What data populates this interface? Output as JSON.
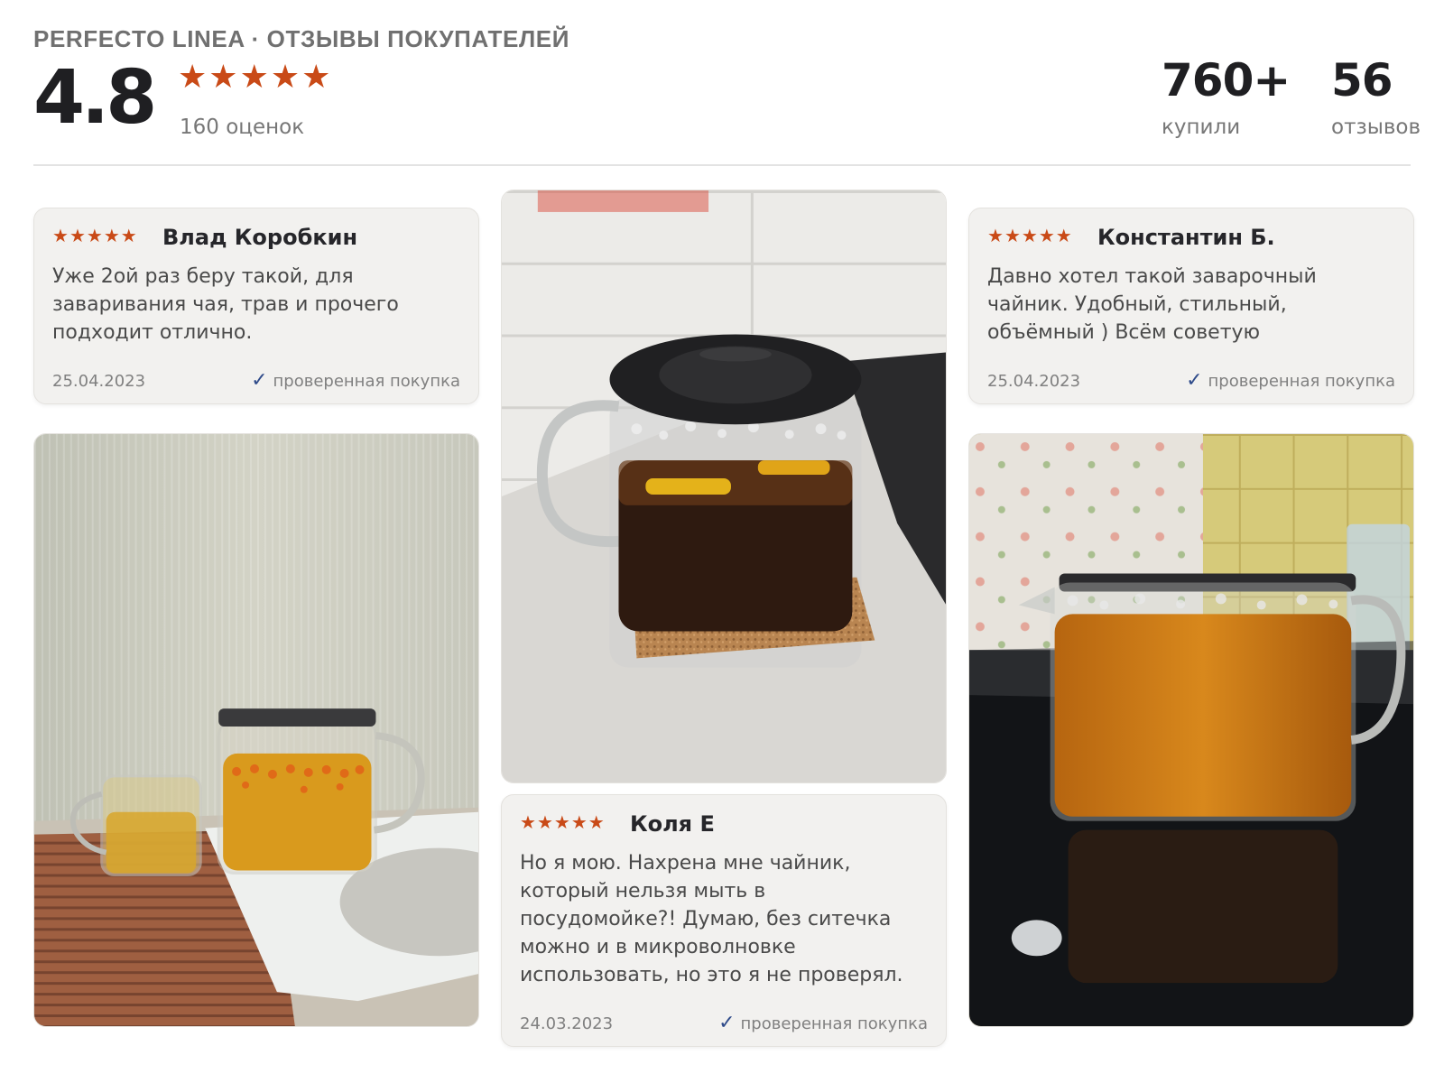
{
  "header": {
    "brand": "PERFECTO LINEA · ОТЗЫВЫ ПОКУПАТЕЛЕЙ",
    "rating": "4.8",
    "stars": 5,
    "ratings_count": "160 оценок",
    "bought": {
      "value": "760+",
      "label": "купили"
    },
    "reviews": {
      "value": "56",
      "label": "отзывов"
    }
  },
  "colors": {
    "star": "#c94a17",
    "check": "#2f4b8a",
    "card_bg": "#f2f1ef"
  },
  "reviews": [
    {
      "author": "Влад Коробкин",
      "stars": 5,
      "text": "Уже 2ой раз беру такой, для заваривания чая, трав и прочего подходит отлично.",
      "date": "25.04.2023",
      "verified": "проверенная покупка"
    },
    {
      "author": "Константин Б.",
      "stars": 5,
      "text": "Давно хотел такой заварочный чайник. Удобный, стильный, объёмный ) Всём советую",
      "date": "25.04.2023",
      "verified": "проверенная покупка"
    },
    {
      "author": "Коля Е",
      "stars": 5,
      "text": "Но я мою. Нахрена мне чайник, который нельзя мыть в посудомойке?! Думаю, без ситечка можно и в микроволновке использовать, но это я не проверял.",
      "date": "24.03.2023",
      "verified": "проверенная покупка"
    }
  ],
  "icons": {
    "star": "star-icon",
    "check": "checkmark-icon"
  }
}
